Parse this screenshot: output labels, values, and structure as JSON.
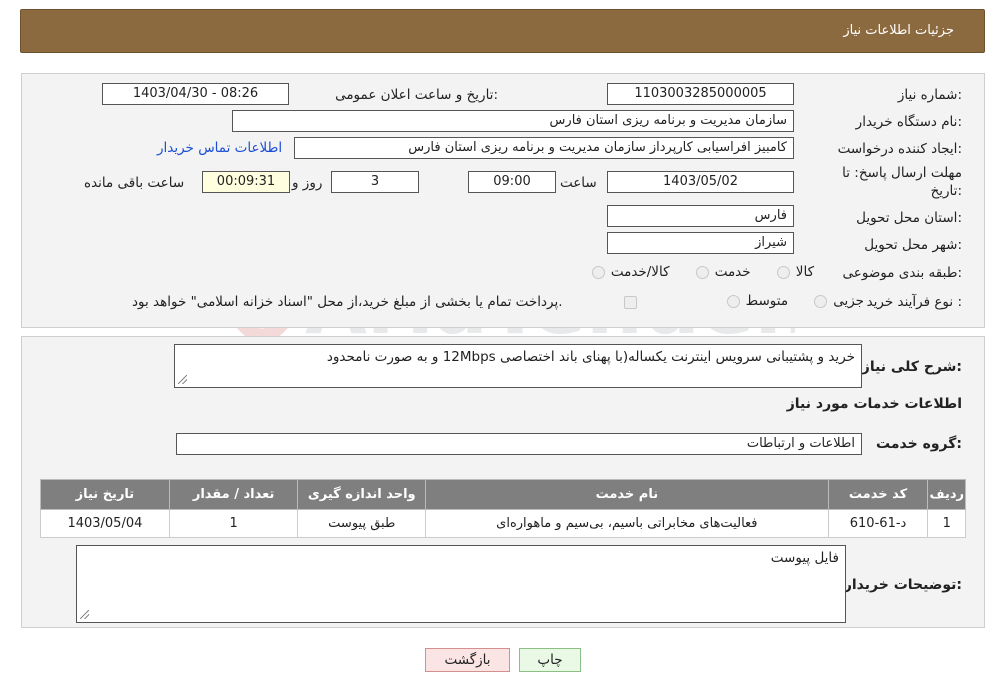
{
  "header": {
    "title": "جزئیات اطلاعات نیاز"
  },
  "form": {
    "need_number": {
      "label": "شماره نیاز:",
      "value": "1103003285000005"
    },
    "announce_datetime": {
      "label": "تاریخ و ساعت اعلان عمومی:",
      "value": "1403/04/30 - 08:26"
    },
    "buyer_org": {
      "label": "نام دستگاه خریدار:",
      "value": "سازمان مدیریت و برنامه ریزی استان فارس"
    },
    "requester": {
      "label": "ایجاد کننده درخواست:",
      "value": "کامبیز افراسیابی کارپرداز سازمان مدیریت و برنامه ریزی استان فارس"
    },
    "buyer_contact_link": "اطلاعات تماس خریدار",
    "deadline": {
      "label_line1": "مهلت ارسال پاسخ: تا",
      "label_line2": "تاریخ:",
      "date": "1403/05/02",
      "time_label": "ساعت",
      "time": "09:00",
      "days": "3",
      "days_label": "روز و",
      "remaining": "00:09:31",
      "remaining_label": "ساعت باقی مانده"
    },
    "province": {
      "label": "استان محل تحویل:",
      "value": "فارس"
    },
    "city": {
      "label": "شهر محل تحویل:",
      "value": "شیراز"
    },
    "category": {
      "label": "طبقه بندی موضوعی:",
      "options": [
        "کالا",
        "خدمت",
        "کالا/خدمت"
      ]
    },
    "purchase_type": {
      "label": "نوع فرآیند خرید :",
      "options": [
        "جزیی",
        "متوسط"
      ],
      "payment_note": "پرداخت تمام یا بخشی از مبلغ خرید،از محل \"اسناد خزانه اسلامی\" خواهد بود."
    }
  },
  "details": {
    "description_label": "شرح کلی نیاز:",
    "description": "خرید و پشتیبانی سرویس اینترنت یکساله(با پهنای باند اختصاصی 12Mbps و به صورت نامحدود",
    "services_heading": "اطلاعات خدمات مورد نیاز",
    "service_group_label": "گروه خدمت:",
    "service_group": "اطلاعات و ارتباطات",
    "table": {
      "headers": [
        "ردیف",
        "کد خدمت",
        "نام خدمت",
        "واحد اندازه گیری",
        "تعداد / مقدار",
        "تاریخ نیاز"
      ],
      "rows": [
        [
          "1",
          "د-61-610",
          "فعالیت‌های مخابراتی باسیم، بی‌سیم و ماهواره‌ای",
          "طبق پیوست",
          "1",
          "1403/05/04"
        ]
      ]
    },
    "buyer_notes_label": "توضیحات خریدار:",
    "buyer_notes": "فایل پیوست"
  },
  "buttons": {
    "print": "چاپ",
    "back": "بازگشت"
  },
  "watermark": "AriaTender.neT"
}
